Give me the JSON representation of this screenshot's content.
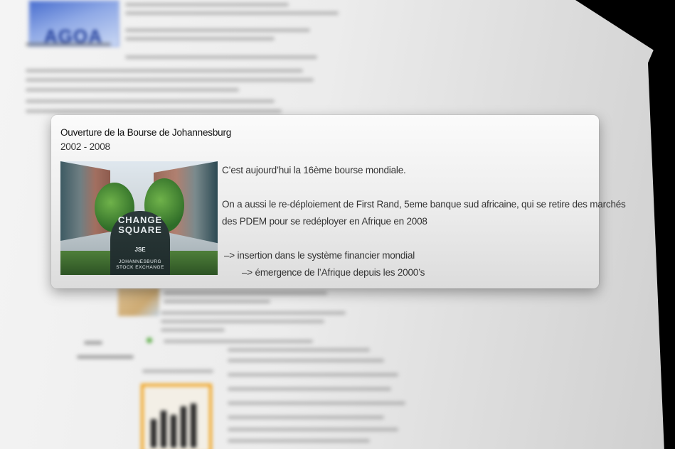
{
  "background": {
    "logo_text": "AGOA"
  },
  "popup": {
    "title": "Ouverture de la Bourse de Johannesburg",
    "dates": "2002 - 2008",
    "image": {
      "sign_text": "CHANGE\nSQUARE",
      "logo_text": "JSE",
      "caption": "JOHANNESBURG\nSTOCK EXCHANGE"
    },
    "body": {
      "line1": "C’est aujourd’hui la 16ème bourse mondiale.",
      "line2": "On a aussi le re-déploiement de First Rand, 5eme banque sud africaine, qui se retire des marchés",
      "line3": "des PDEM pour se redéployer en Afrique en 2008",
      "line4": "–> insertion dans le système financier mondial",
      "line5": "–> émergence de l’Afrique depuis les 2000’s"
    }
  },
  "colors": {
    "popup_bg_top": "#fbfbfb",
    "popup_bg_bottom": "#dcdcdc",
    "accent_orange": "#f0a21c",
    "agoa_blue": "#233f9a"
  }
}
